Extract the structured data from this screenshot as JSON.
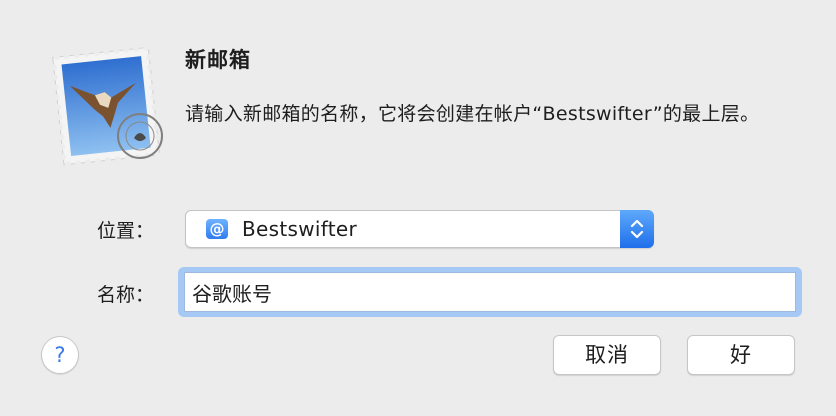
{
  "dialog": {
    "title": "新邮箱",
    "description": "请输入新邮箱的名称，它将会创建在帐户“Bestswifter”的最上层。",
    "app_icon": "mail-stamp-icon"
  },
  "location": {
    "label": "位置：",
    "account_icon": "at-sign-icon",
    "account_icon_glyph": "@",
    "value": "Bestswifter",
    "stepper_icon": "up-down-chevron-icon"
  },
  "name": {
    "label": "名称：",
    "value": "谷歌账号"
  },
  "buttons": {
    "help": "?",
    "cancel": "取消",
    "ok": "好"
  },
  "colors": {
    "accent": "#1f6fea",
    "focus_ring": "#a6c8f5",
    "window_bg": "#ececec"
  }
}
